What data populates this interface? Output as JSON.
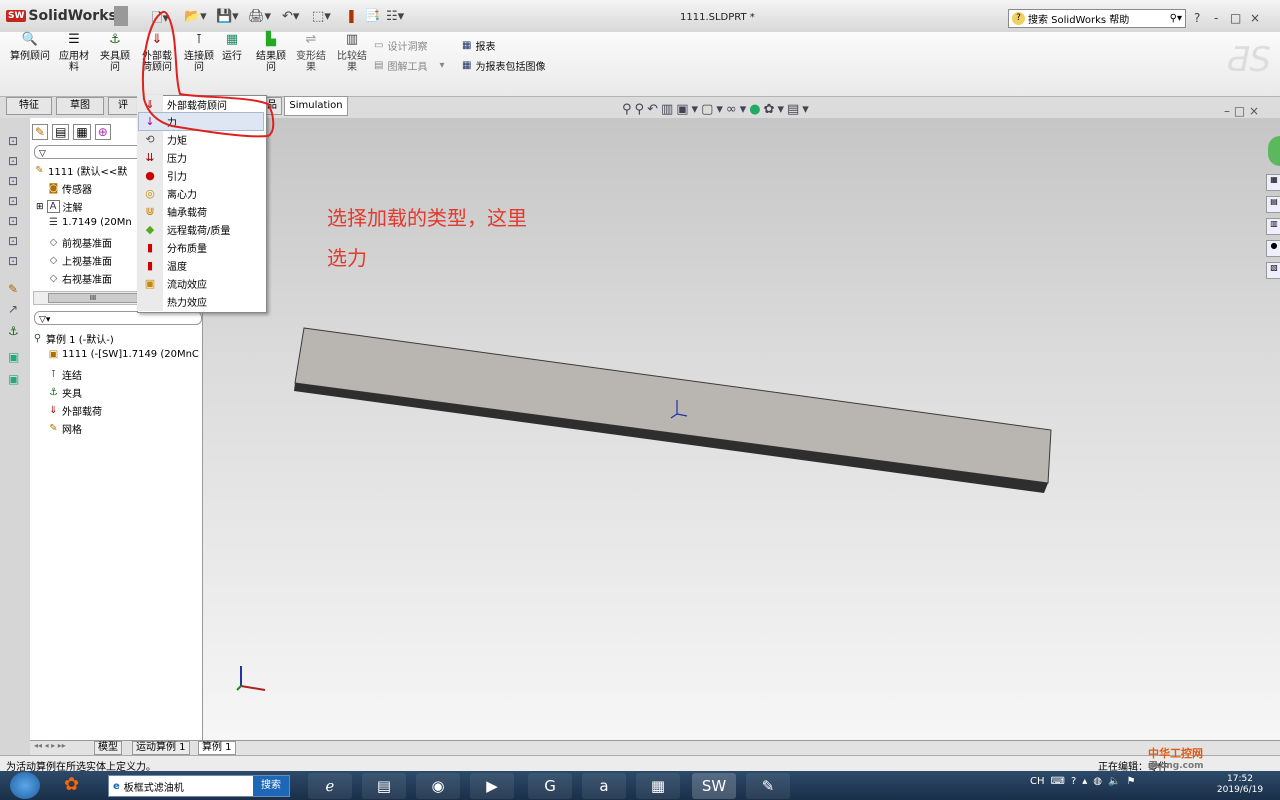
{
  "titlebar": {
    "app_name": "SolidWorks",
    "document": "1111.SLDPRT *",
    "help_search": "搜索 SolidWorks 帮助",
    "window_controls": [
      "?",
      "-",
      "□",
      "×"
    ]
  },
  "ribbon": {
    "buttons": [
      {
        "label": "算例顾问"
      },
      {
        "label": "应用材料"
      },
      {
        "label": "夹具顾问"
      },
      {
        "label": "外部载荷顾问"
      },
      {
        "label": "连接顾问"
      },
      {
        "label": "运行"
      },
      {
        "label": "结果顾问"
      },
      {
        "label": "变形结果"
      },
      {
        "label": "比较结果"
      }
    ],
    "small": [
      {
        "label": "设计洞察",
        "enabled": false
      },
      {
        "label": "图解工具",
        "enabled": false
      },
      {
        "label": "报表",
        "enabled": true
      },
      {
        "label": "为报表包括图像",
        "enabled": true
      }
    ]
  },
  "tabs": [
    "特征",
    "草图",
    "评",
    "品",
    "Simulation"
  ],
  "dropdown": {
    "items": [
      {
        "label": "外部载荷顾问",
        "icon": "load-advisor-icon"
      },
      {
        "label": "力",
        "icon": "force-arrow-icon",
        "selected": true
      },
      {
        "label": "力矩",
        "icon": "torque-icon"
      },
      {
        "label": "压力",
        "icon": "pressure-icon"
      },
      {
        "label": "引力",
        "icon": "gravity-icon"
      },
      {
        "label": "离心力",
        "icon": "centrifugal-icon"
      },
      {
        "label": "轴承载荷",
        "icon": "bearing-load-icon"
      },
      {
        "label": "远程载荷/质量",
        "icon": "remote-load-icon"
      },
      {
        "label": "分布质量",
        "icon": "distributed-mass-icon"
      },
      {
        "label": "温度",
        "icon": "thermometer-icon"
      },
      {
        "label": "流动效应",
        "icon": "flow-effect-icon"
      },
      {
        "label": "热力效应",
        "icon": "thermal-effect-icon"
      }
    ]
  },
  "feature_tree": {
    "items": [
      {
        "label": "1111  (默认<<默",
        "indent": 0
      },
      {
        "label": "传感器",
        "indent": 1
      },
      {
        "label": "注解",
        "indent": 1
      },
      {
        "label": "1.7149 (20Mn",
        "indent": 1
      },
      {
        "label": "前视基准面",
        "indent": 1
      },
      {
        "label": "上视基准面",
        "indent": 1
      },
      {
        "label": "右视基准面",
        "indent": 1
      }
    ],
    "scroll_label": "III"
  },
  "study_tree": {
    "items": [
      {
        "label": "算例 1 (-默认-)",
        "indent": 0
      },
      {
        "label": "1111 (-[SW]1.7149 (20MnC",
        "indent": 1
      },
      {
        "label": "连结",
        "indent": 1
      },
      {
        "label": "夹具",
        "indent": 1
      },
      {
        "label": "外部载荷",
        "indent": 1
      },
      {
        "label": "网格",
        "indent": 1
      }
    ]
  },
  "annotation": {
    "line1": "选择加载的类型，这里",
    "line2": "选力",
    "color": "#e23a2c"
  },
  "bottom_tabs": [
    "模型",
    "运动算例 1",
    "算例 1"
  ],
  "status": {
    "message": "为活动算例在所选实体上定义力。",
    "right": "正在编辑：零件"
  },
  "taskbar": {
    "search_placeholder": "板框式滤油机",
    "search_button": "搜索",
    "tray_lang": "CH",
    "time": "17:52",
    "date": "2019/6/19"
  },
  "watermark": {
    "line1": "中华工控网",
    "line2": "gkong.com"
  }
}
